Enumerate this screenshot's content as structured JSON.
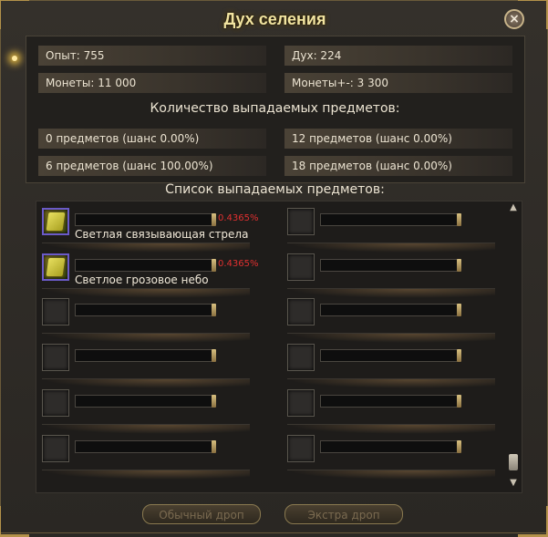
{
  "window": {
    "title": "Дух селения",
    "close_label": "×"
  },
  "stats": {
    "exp": "Опыт: 755",
    "spirit": "Дух: 224",
    "coins": "Монеты: 11 000",
    "coins_pm": "Монеты+-: 3 300"
  },
  "drop_count": {
    "title": "Количество выпадаемых предметов:",
    "options": [
      "0 предметов (шанс 0.00%)",
      "12 предметов (шанс 0.00%)",
      "6 предметов (шанс 100.00%)",
      "18 предметов (шанс 0.00%)"
    ]
  },
  "drop_list": {
    "title": "Список выпадаемых предметов:",
    "items": [
      {
        "name": "Светлая связывающая стрела",
        "chance": "0.4365%"
      },
      {
        "name": "Светлое грозовое небо",
        "chance": "0.4365%"
      }
    ]
  },
  "buttons": {
    "normal": "Обычный дроп",
    "extra": "Экстра дроп"
  },
  "colors": {
    "title": "#f2e4a0",
    "chance": "#e03030",
    "frame": "#b4924a"
  }
}
